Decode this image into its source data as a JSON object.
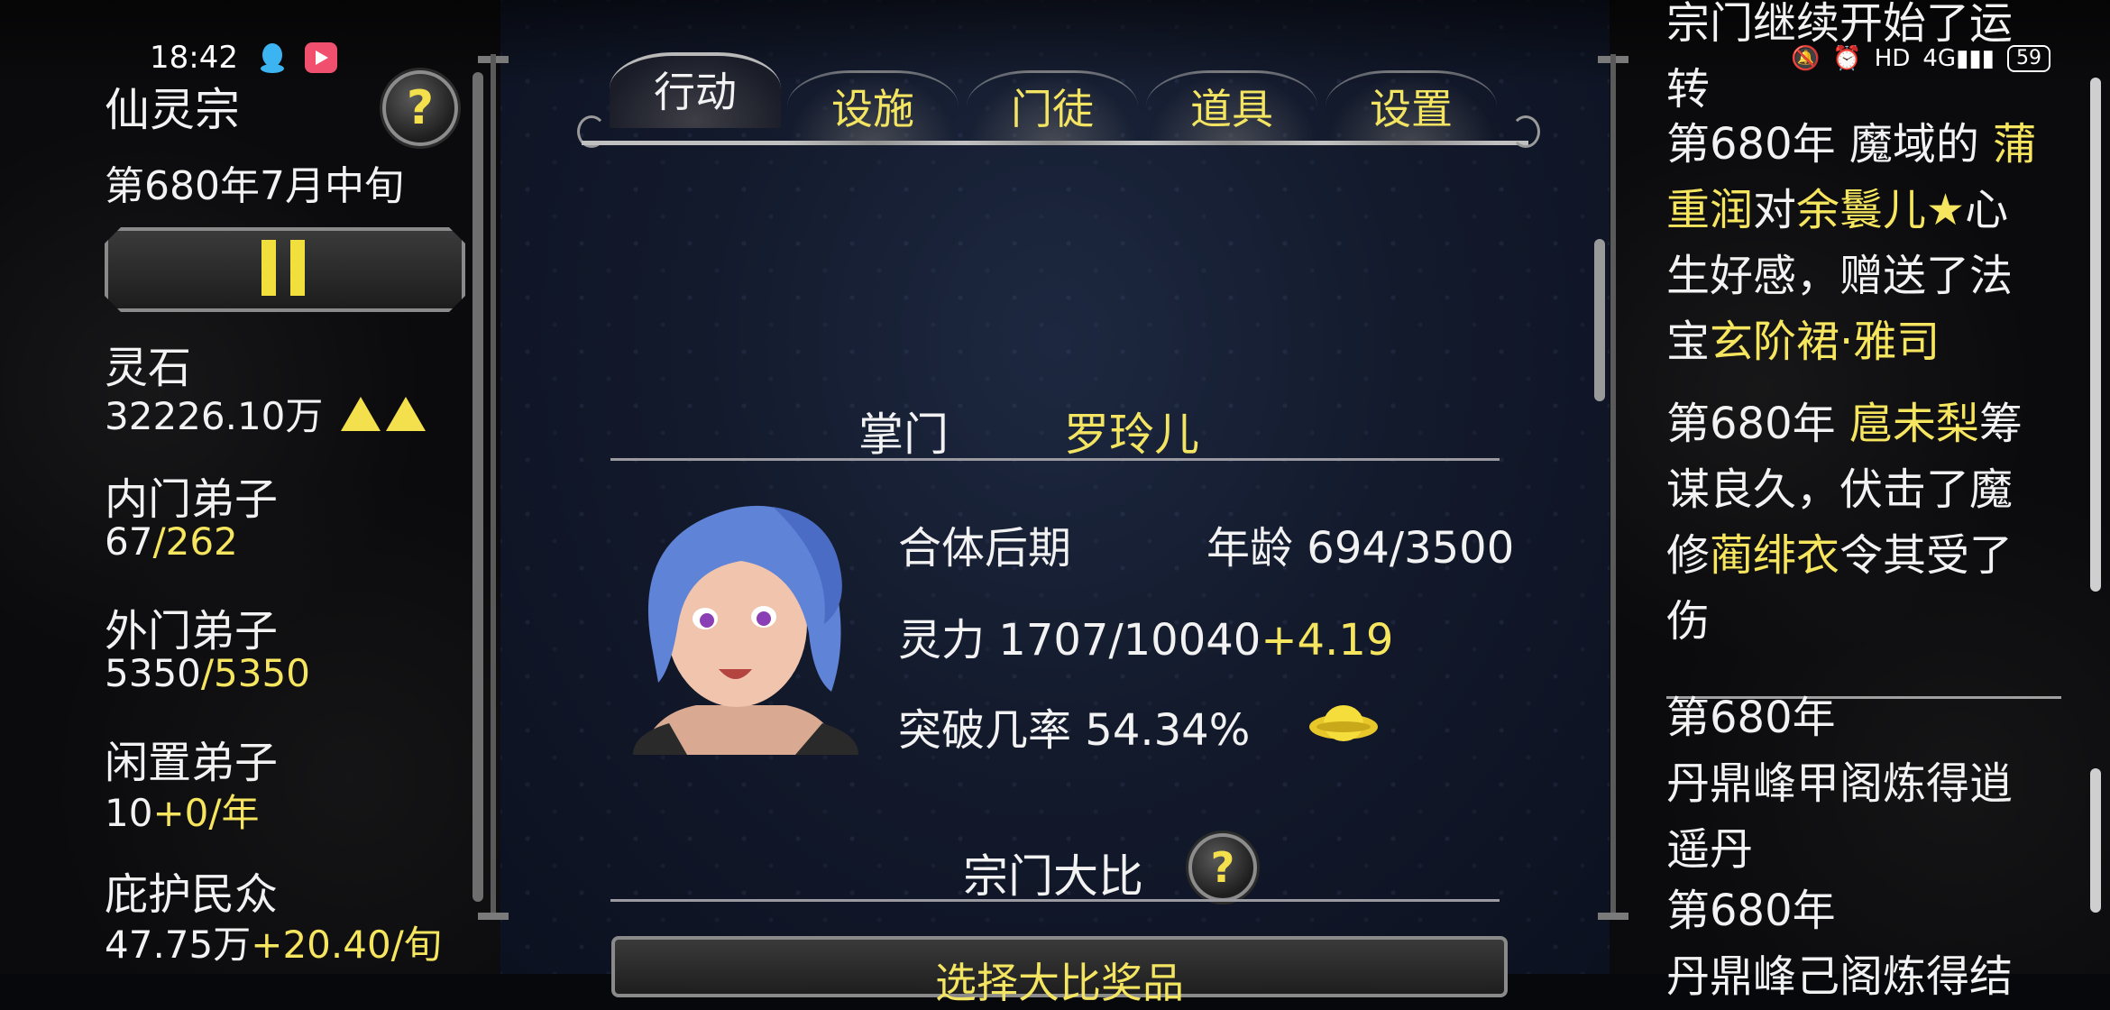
{
  "status_bar": {
    "time": "18:42",
    "icons": [
      "qq-icon",
      "video-app-icon",
      "mute-icon",
      "alarm-icon",
      "hd-icon",
      "4g-signal-icon",
      "battery-icon"
    ],
    "hd": "HD",
    "network": "4G",
    "battery": "59"
  },
  "left": {
    "sect_name": "仙灵宗",
    "date": "第680年7月中旬",
    "stats": [
      {
        "label": "灵石",
        "value": "32226.10万",
        "extra": ""
      },
      {
        "label": "内门弟子",
        "value": "67",
        "extra": "/262"
      },
      {
        "label": "外门弟子",
        "value": "5350",
        "extra": "/5350"
      },
      {
        "label": "闲置弟子",
        "value": "10",
        "extra": "+0/年"
      },
      {
        "label": "庇护民众",
        "value": "47.75万",
        "extra": "+20.40/旬"
      }
    ]
  },
  "tabs": [
    "行动",
    "设施",
    "门徒",
    "道具",
    "设置"
  ],
  "active_tab": "行动",
  "master": {
    "label": "掌门",
    "name": "罗玲儿",
    "realm": "合体后期",
    "age_label": "年龄",
    "age": "694/3500",
    "power_label": "灵力",
    "power": "1707/10040",
    "power_gain": "+4.19",
    "break_label": "突破几率",
    "break_rate": "54.34%"
  },
  "competition": {
    "title": "宗门大比",
    "button": "选择大比奖品"
  },
  "log": {
    "top_partial": "宗门继续开始了运转",
    "entry1": {
      "pre": "第680年 魔域的 ",
      "n1": "蒲重润",
      "mid": "对",
      "n2": "余鬟儿★",
      "post": "心生好感，赠送了法宝",
      "item": "玄阶裙·雅司"
    },
    "entry2": {
      "pre": "第680年 ",
      "n1": "扈未梨",
      "mid": "筹谋良久，伏击了魔修",
      "n2": "蔺绯衣",
      "post": "令其受了伤"
    },
    "entry3": {
      "year": "第680年",
      "text": "丹鼎峰甲阁炼得逍遥丹"
    },
    "entry4": {
      "year": "第680年",
      "text": "丹鼎峰己阁炼得结"
    }
  },
  "colors": {
    "accent": "#f3e461",
    "panel_bg": "#141b2d"
  }
}
